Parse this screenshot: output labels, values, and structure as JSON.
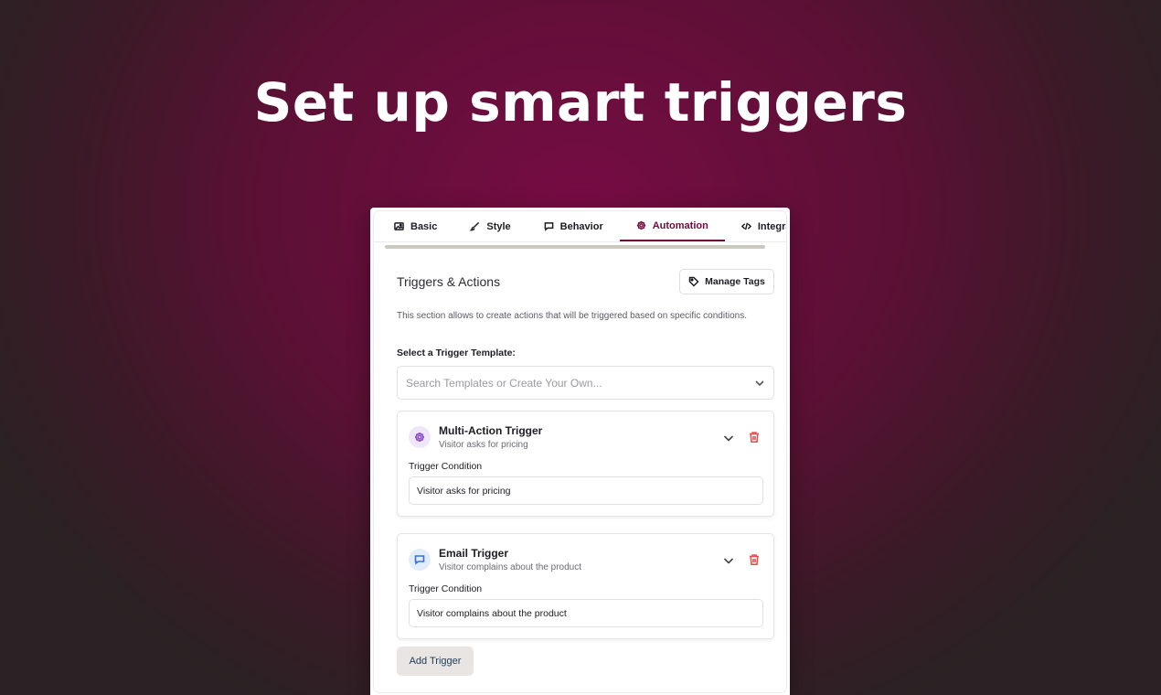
{
  "headline": "Set up smart triggers",
  "tabs": [
    {
      "label": "Basic",
      "icon": "image-icon",
      "active": false
    },
    {
      "label": "Style",
      "icon": "brush-icon",
      "active": false
    },
    {
      "label": "Behavior",
      "icon": "chat-icon",
      "active": false
    },
    {
      "label": "Automation",
      "icon": "gear-icon",
      "active": true
    },
    {
      "label": "Integratio",
      "icon": "code-icon",
      "active": false
    }
  ],
  "section": {
    "title": "Triggers & Actions",
    "manage_tags_label": "Manage Tags",
    "description": "This section allows to create actions that will be triggered based on specific conditions.",
    "select_label": "Select a Trigger Template:",
    "select_placeholder": "Search Templates or Create Your Own..."
  },
  "triggers": [
    {
      "name": "Multi-Action Trigger",
      "subtitle": "Visitor asks for pricing",
      "icon": "gear-icon",
      "icon_color": "#8a4fc7",
      "icon_bg": "#f0e6fa",
      "condition_label": "Trigger Condition",
      "condition_value": "Visitor asks for pricing"
    },
    {
      "name": "Email Trigger",
      "subtitle": "Visitor complains about the product",
      "icon": "chat-icon",
      "icon_color": "#3b6fd6",
      "icon_bg": "#e3ecfb",
      "condition_label": "Trigger Condition",
      "condition_value": "Visitor complains about the product"
    }
  ],
  "add_trigger_label": "Add Trigger",
  "colors": {
    "accent": "#6e0c3c",
    "danger": "#e05454"
  }
}
